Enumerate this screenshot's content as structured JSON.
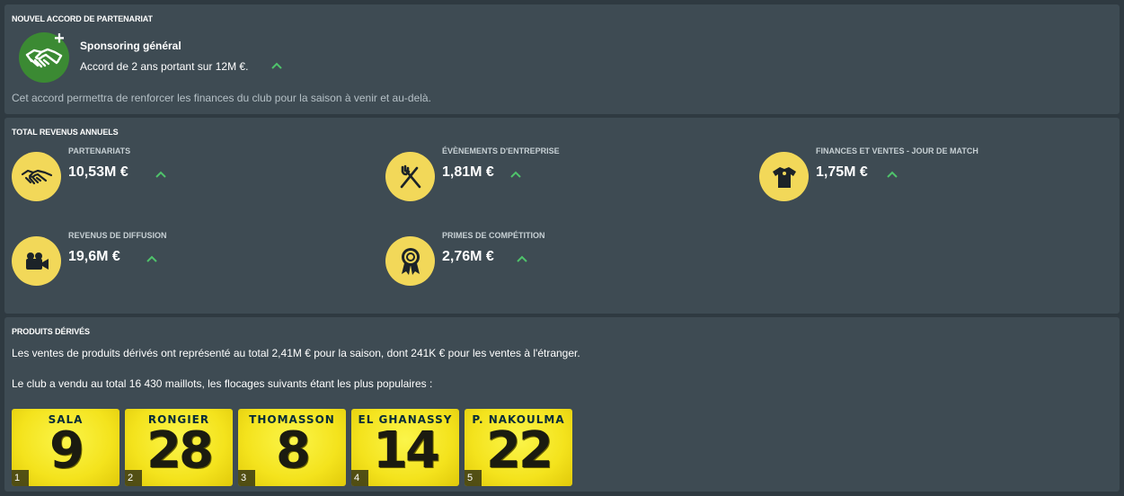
{
  "partnership": {
    "title": "NOUVEL ACCORD DE PARTENARIAT",
    "deal_name": "Sponsoring général",
    "deal_desc": "Accord de 2 ans portant sur 12M €.",
    "note": "Cet accord permettra de renforcer les finances du club pour la saison à venir et au-delà.",
    "icon": "handshake-plus-icon",
    "icon_color": "#3b8a33"
  },
  "revenue": {
    "title": "TOTAL REVENUS ANNUELS",
    "accent": "#f2d859",
    "trend_color": "#4fc36b",
    "items": [
      {
        "label": "Partenariats",
        "value": "10,53M €",
        "icon": "handshake-icon",
        "trend": "up"
      },
      {
        "label": "Évènements d'entreprise",
        "value": "1,81M €",
        "icon": "fork-knife-icon",
        "trend": "up"
      },
      {
        "label": "Finances et ventes - jour de match",
        "value": "1,75M €",
        "icon": "shirt-icon",
        "trend": "up"
      },
      {
        "label": "Revenus de diffusion",
        "value": "19,6M €",
        "icon": "video-camera-icon",
        "trend": "up"
      },
      {
        "label": "Primes de compétition",
        "value": "2,76M €",
        "icon": "award-ribbon-icon",
        "trend": "up"
      }
    ]
  },
  "merch": {
    "title": "PRODUITS DÉRIVÉS",
    "line1": "Les ventes de produits dérivés ont représenté au total 2,41M € pour la saison, dont 241K € pour les ventes à l'étranger.",
    "line2": "Le club a vendu au total 16 430 maillots, les flocages suivants étant les plus populaires :",
    "shirts": [
      {
        "rank": "1",
        "name": "SALA",
        "number": "9"
      },
      {
        "rank": "2",
        "name": "RONGIER",
        "number": "28"
      },
      {
        "rank": "3",
        "name": "THOMASSON",
        "number": "8"
      },
      {
        "rank": "4",
        "name": "EL GHANASSY",
        "number": "14"
      },
      {
        "rank": "5",
        "name": "P. NAKOULMA",
        "number": "22"
      }
    ]
  }
}
